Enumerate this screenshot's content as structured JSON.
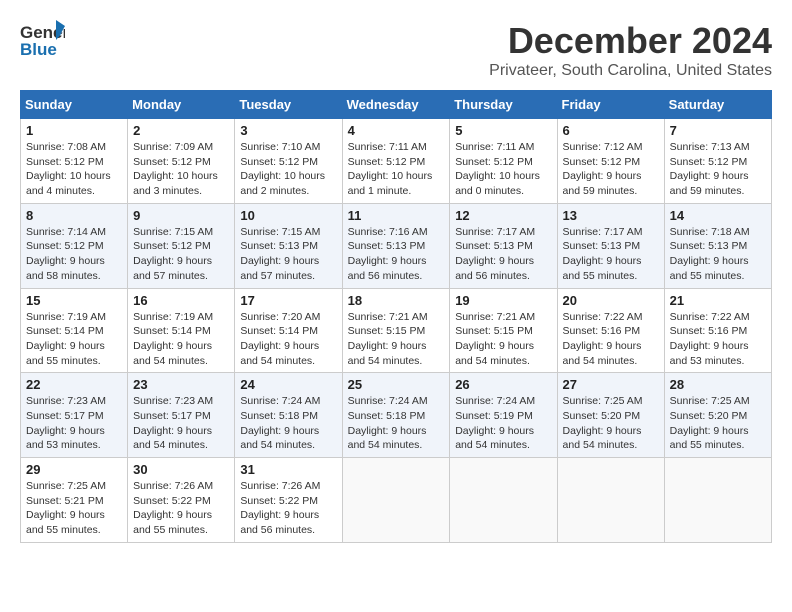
{
  "logo": {
    "line1": "General",
    "line2": "Blue"
  },
  "title": "December 2024",
  "location": "Privateer, South Carolina, United States",
  "days_of_week": [
    "Sunday",
    "Monday",
    "Tuesday",
    "Wednesday",
    "Thursday",
    "Friday",
    "Saturday"
  ],
  "weeks": [
    [
      {
        "day": "1",
        "info": "Sunrise: 7:08 AM\nSunset: 5:12 PM\nDaylight: 10 hours\nand 4 minutes."
      },
      {
        "day": "2",
        "info": "Sunrise: 7:09 AM\nSunset: 5:12 PM\nDaylight: 10 hours\nand 3 minutes."
      },
      {
        "day": "3",
        "info": "Sunrise: 7:10 AM\nSunset: 5:12 PM\nDaylight: 10 hours\nand 2 minutes."
      },
      {
        "day": "4",
        "info": "Sunrise: 7:11 AM\nSunset: 5:12 PM\nDaylight: 10 hours\nand 1 minute."
      },
      {
        "day": "5",
        "info": "Sunrise: 7:11 AM\nSunset: 5:12 PM\nDaylight: 10 hours\nand 0 minutes."
      },
      {
        "day": "6",
        "info": "Sunrise: 7:12 AM\nSunset: 5:12 PM\nDaylight: 9 hours\nand 59 minutes."
      },
      {
        "day": "7",
        "info": "Sunrise: 7:13 AM\nSunset: 5:12 PM\nDaylight: 9 hours\nand 59 minutes."
      }
    ],
    [
      {
        "day": "8",
        "info": "Sunrise: 7:14 AM\nSunset: 5:12 PM\nDaylight: 9 hours\nand 58 minutes."
      },
      {
        "day": "9",
        "info": "Sunrise: 7:15 AM\nSunset: 5:12 PM\nDaylight: 9 hours\nand 57 minutes."
      },
      {
        "day": "10",
        "info": "Sunrise: 7:15 AM\nSunset: 5:13 PM\nDaylight: 9 hours\nand 57 minutes."
      },
      {
        "day": "11",
        "info": "Sunrise: 7:16 AM\nSunset: 5:13 PM\nDaylight: 9 hours\nand 56 minutes."
      },
      {
        "day": "12",
        "info": "Sunrise: 7:17 AM\nSunset: 5:13 PM\nDaylight: 9 hours\nand 56 minutes."
      },
      {
        "day": "13",
        "info": "Sunrise: 7:17 AM\nSunset: 5:13 PM\nDaylight: 9 hours\nand 55 minutes."
      },
      {
        "day": "14",
        "info": "Sunrise: 7:18 AM\nSunset: 5:13 PM\nDaylight: 9 hours\nand 55 minutes."
      }
    ],
    [
      {
        "day": "15",
        "info": "Sunrise: 7:19 AM\nSunset: 5:14 PM\nDaylight: 9 hours\nand 55 minutes."
      },
      {
        "day": "16",
        "info": "Sunrise: 7:19 AM\nSunset: 5:14 PM\nDaylight: 9 hours\nand 54 minutes."
      },
      {
        "day": "17",
        "info": "Sunrise: 7:20 AM\nSunset: 5:14 PM\nDaylight: 9 hours\nand 54 minutes."
      },
      {
        "day": "18",
        "info": "Sunrise: 7:21 AM\nSunset: 5:15 PM\nDaylight: 9 hours\nand 54 minutes."
      },
      {
        "day": "19",
        "info": "Sunrise: 7:21 AM\nSunset: 5:15 PM\nDaylight: 9 hours\nand 54 minutes."
      },
      {
        "day": "20",
        "info": "Sunrise: 7:22 AM\nSunset: 5:16 PM\nDaylight: 9 hours\nand 54 minutes."
      },
      {
        "day": "21",
        "info": "Sunrise: 7:22 AM\nSunset: 5:16 PM\nDaylight: 9 hours\nand 53 minutes."
      }
    ],
    [
      {
        "day": "22",
        "info": "Sunrise: 7:23 AM\nSunset: 5:17 PM\nDaylight: 9 hours\nand 53 minutes."
      },
      {
        "day": "23",
        "info": "Sunrise: 7:23 AM\nSunset: 5:17 PM\nDaylight: 9 hours\nand 54 minutes."
      },
      {
        "day": "24",
        "info": "Sunrise: 7:24 AM\nSunset: 5:18 PM\nDaylight: 9 hours\nand 54 minutes."
      },
      {
        "day": "25",
        "info": "Sunrise: 7:24 AM\nSunset: 5:18 PM\nDaylight: 9 hours\nand 54 minutes."
      },
      {
        "day": "26",
        "info": "Sunrise: 7:24 AM\nSunset: 5:19 PM\nDaylight: 9 hours\nand 54 minutes."
      },
      {
        "day": "27",
        "info": "Sunrise: 7:25 AM\nSunset: 5:20 PM\nDaylight: 9 hours\nand 54 minutes."
      },
      {
        "day": "28",
        "info": "Sunrise: 7:25 AM\nSunset: 5:20 PM\nDaylight: 9 hours\nand 55 minutes."
      }
    ],
    [
      {
        "day": "29",
        "info": "Sunrise: 7:25 AM\nSunset: 5:21 PM\nDaylight: 9 hours\nand 55 minutes."
      },
      {
        "day": "30",
        "info": "Sunrise: 7:26 AM\nSunset: 5:22 PM\nDaylight: 9 hours\nand 55 minutes."
      },
      {
        "day": "31",
        "info": "Sunrise: 7:26 AM\nSunset: 5:22 PM\nDaylight: 9 hours\nand 56 minutes."
      },
      {
        "day": "",
        "info": ""
      },
      {
        "day": "",
        "info": ""
      },
      {
        "day": "",
        "info": ""
      },
      {
        "day": "",
        "info": ""
      }
    ]
  ]
}
